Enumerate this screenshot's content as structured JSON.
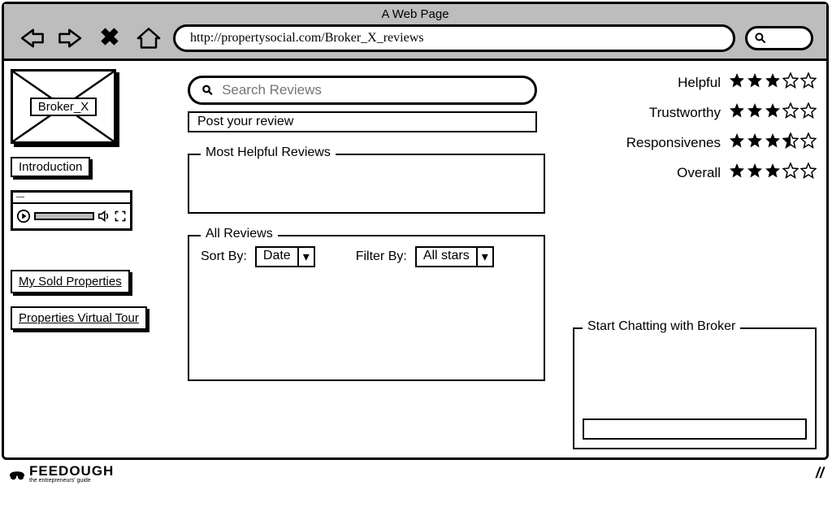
{
  "window": {
    "title": "A Web Page",
    "url": "http://propertysocial.com/Broker_X_reviews"
  },
  "sidebar": {
    "broker_image_label": "Broker_X",
    "introduction_btn": "Introduction",
    "my_sold_link": "My Sold Properties",
    "virtual_tour_link": "Properties Virtual Tour"
  },
  "search": {
    "placeholder": "Search Reviews"
  },
  "post_review": {
    "label": "Post your review"
  },
  "sections": {
    "most_helpful": "Most Helpful Reviews",
    "all_reviews": "All Reviews",
    "chat": "Start Chatting with Broker"
  },
  "filters": {
    "sort_label": "Sort By:",
    "sort_value": "Date",
    "filter_label": "Filter By:",
    "filter_value": "All stars"
  },
  "ratings": {
    "items": [
      {
        "label": "Helpful",
        "stars": 3.0
      },
      {
        "label": "Trustworthy",
        "stars": 3.0
      },
      {
        "label": "Responsivenes",
        "stars": 3.5
      },
      {
        "label": "Overall",
        "stars": 3.0
      }
    ]
  },
  "footer": {
    "brand": "FEEDOUGH",
    "tagline": "the entrepreneurs' guide"
  }
}
